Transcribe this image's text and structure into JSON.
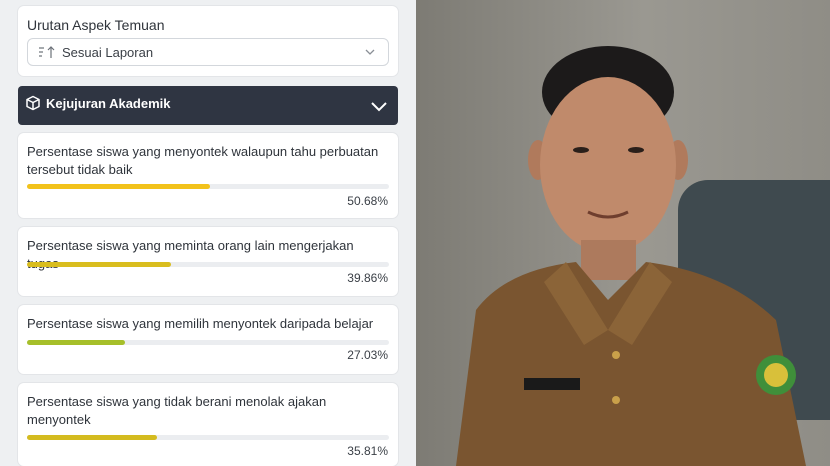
{
  "sort": {
    "title": "Urutan Aspek Temuan",
    "value": "Sesuai Laporan"
  },
  "section": {
    "title": "Kejujuran Akademik"
  },
  "items": [
    {
      "label": "Persentase siswa yang menyontek walaupun tahu perbuatan tersebut tidak baik",
      "percent_text": "50.68%",
      "value": 50.68,
      "color": "#f2c21b"
    },
    {
      "label": "Persentase siswa yang meminta orang lain mengerjakan tugas",
      "percent_text": "39.86%",
      "value": 39.86,
      "color": "#d9bd1e"
    },
    {
      "label": "Persentase siswa yang memilih menyontek daripada belajar",
      "percent_text": "27.03%",
      "value": 27.03,
      "color": "#a6bf2a"
    },
    {
      "label": "Persentase siswa yang tidak berani menolak ajakan menyontek",
      "percent_text": "35.81%",
      "value": 35.81,
      "color": "#d4bb1f"
    }
  ],
  "colors": {
    "header_bg": "#2f3542",
    "track": "#ebedf0"
  },
  "icons": {
    "sort": "sort-ascending-icon",
    "chevron_down": "chevron-down-icon",
    "cube": "cube-icon",
    "chevron_section": "chevron-down-icon"
  }
}
